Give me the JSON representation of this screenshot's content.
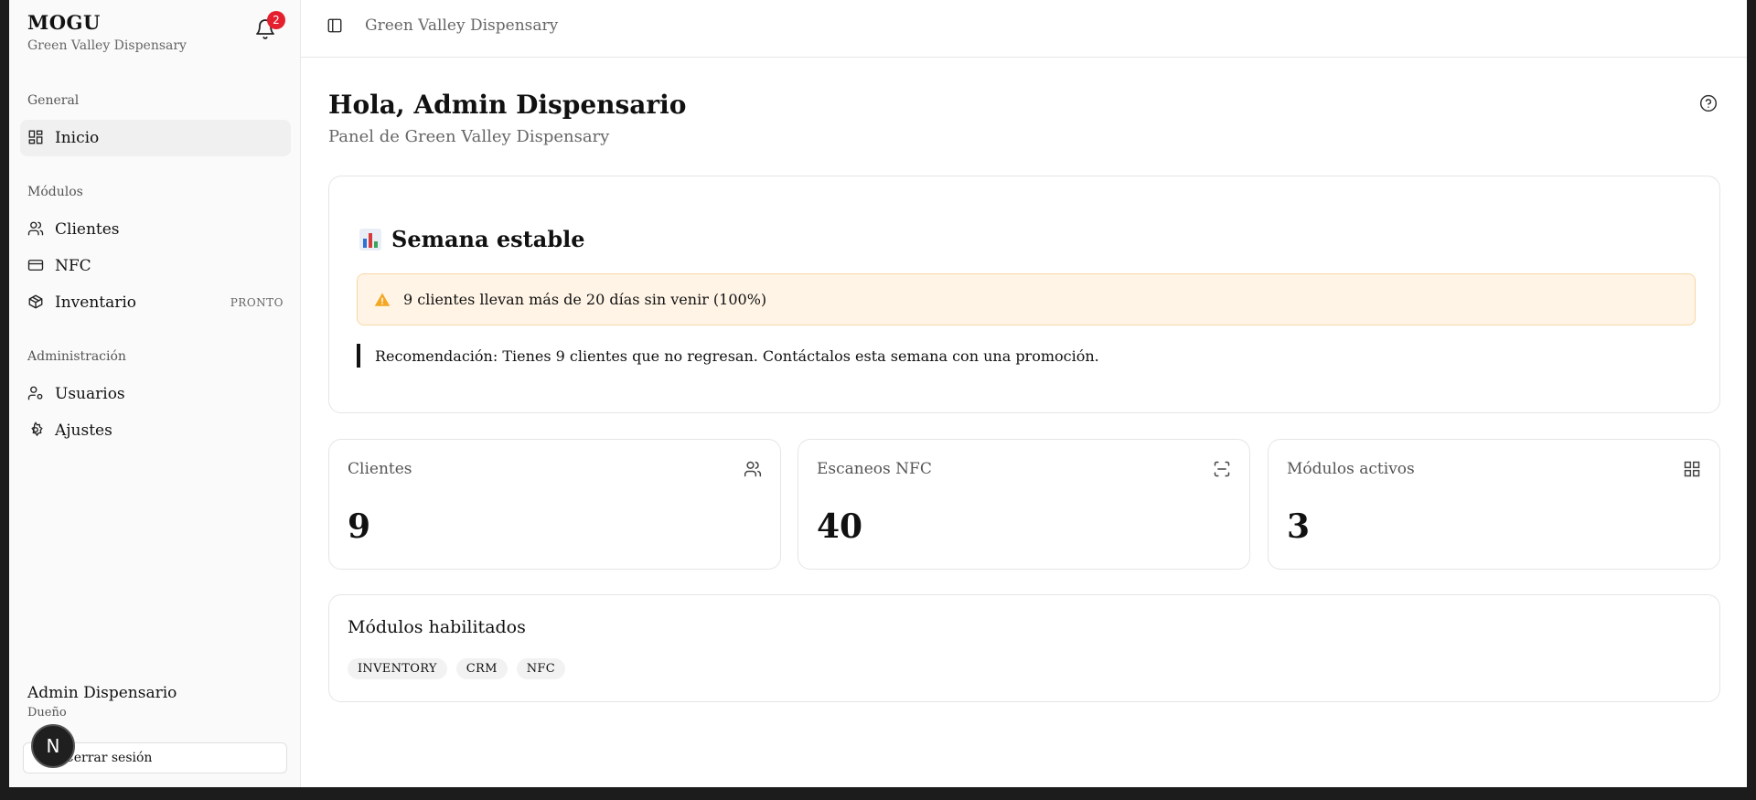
{
  "sidebar": {
    "brand_title": "MOGU",
    "brand_subtitle": "Green Valley Dispensary",
    "notifications_count": "2",
    "sections": {
      "general": "General",
      "modules": "Módulos",
      "admin": "Administración"
    },
    "items": [
      {
        "label": "Inicio",
        "icon": "dashboard-icon",
        "active": true
      },
      {
        "label": "Clientes",
        "icon": "users-icon"
      },
      {
        "label": "NFC",
        "icon": "card-icon"
      },
      {
        "label": "Inventario",
        "icon": "package-icon",
        "tag": "PRONTO"
      },
      {
        "label": "Usuarios",
        "icon": "user-cog-icon"
      },
      {
        "label": "Ajustes",
        "icon": "gear-icon"
      }
    ],
    "user": {
      "name": "Admin Dispensario",
      "role": "Dueño"
    },
    "logout_label": "Cerrar sesión",
    "dev_badge": "N"
  },
  "topbar": {
    "title": "Green Valley Dispensary"
  },
  "header": {
    "greeting": "Hola, Admin Dispensario",
    "subtitle": "Panel de Green Valley Dispensary"
  },
  "insight": {
    "title": "Semana estable",
    "alert": "9 clientes llevan más de 20 días sin venir (100%)",
    "recommendation": "Recomendación: Tienes 9 clientes que no regresan. Contáctalos esta semana con una promoción."
  },
  "stats": [
    {
      "label": "Clientes",
      "value": "9",
      "icon": "users-icon"
    },
    {
      "label": "Escaneos NFC",
      "value": "40",
      "icon": "scan-icon"
    },
    {
      "label": "Módulos activos",
      "value": "3",
      "icon": "grid-icon"
    }
  ],
  "modules": {
    "title": "Módulos habilitados",
    "chips": [
      "INVENTORY",
      "CRM",
      "NFC"
    ]
  },
  "colors": {
    "alert_bg": "#fff4e5",
    "badge": "#e5202e",
    "accent": "#111111"
  }
}
